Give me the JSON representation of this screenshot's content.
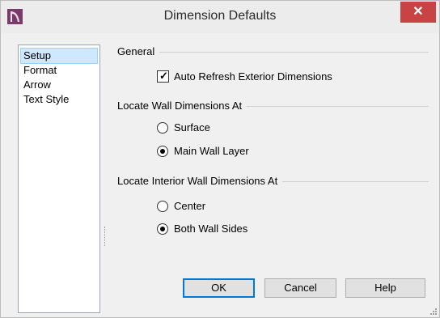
{
  "window": {
    "title": "Dimension Defaults",
    "close_glyph": "✕"
  },
  "nav": {
    "items": [
      {
        "label": "Setup",
        "selected": true
      },
      {
        "label": "Format",
        "selected": false
      },
      {
        "label": "Arrow",
        "selected": false
      },
      {
        "label": "Text Style",
        "selected": false
      }
    ]
  },
  "general": {
    "label": "General",
    "auto_refresh": {
      "label": "Auto Refresh Exterior Dimensions",
      "checked": true
    }
  },
  "wall_dims": {
    "label": "Locate Wall Dimensions At",
    "options": [
      {
        "label": "Surface",
        "selected": false
      },
      {
        "label": "Main Wall Layer",
        "selected": true
      }
    ]
  },
  "interior_dims": {
    "label": "Locate Interior Wall Dimensions At",
    "options": [
      {
        "label": "Center",
        "selected": false
      },
      {
        "label": "Both Wall Sides",
        "selected": true
      }
    ]
  },
  "buttons": {
    "ok": "OK",
    "cancel": "Cancel",
    "help": "Help"
  },
  "colors": {
    "accent": "#0078d7",
    "close": "#c84343",
    "selection": "#cde8ff",
    "app_icon": "#7a3b6b"
  },
  "icons": {
    "app": "app-logo-icon",
    "close": "close-icon",
    "grip": "resize-grip-icon"
  }
}
